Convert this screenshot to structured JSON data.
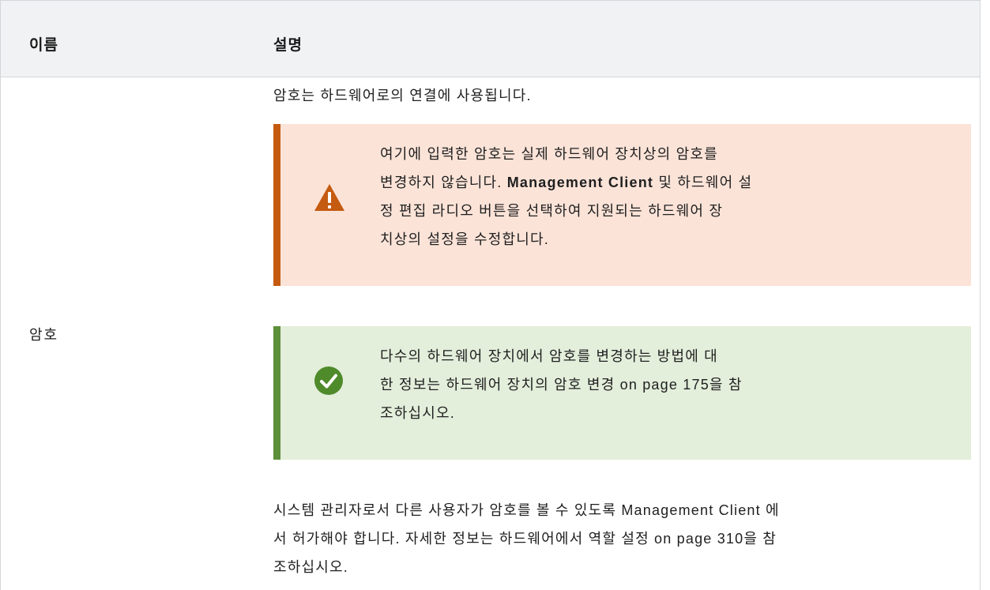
{
  "table": {
    "headers": {
      "name": "이름",
      "description": "설명"
    },
    "row": {
      "name": "암호",
      "intro": "암호는 하드웨어로의 연결에 사용됩니다.",
      "warning": {
        "line1": "여기에 입력한 암호는 실제 하드웨어 장치상의 암호를",
        "line2_prefix": "변경하지 않습니다. ",
        "line2_bold": "Management Client",
        "line2_suffix": " 및 하드웨어 설",
        "line3": "정 편집 라디오 버튼을 선택하여 지원되는 하드웨어 장",
        "line4": "치상의 설정을 수정합니다.",
        "icon": "warning-triangle-icon",
        "accent_color": "#c55a11",
        "background": "#fbe3d8"
      },
      "tip": {
        "line1": "다수의 하드웨어 장치에서 암호를 변경하는 방법에 대",
        "line2": "한 정보는 하드웨어 장치의 암호 변경 on page 175을 참",
        "line3": "조하십시오.",
        "icon": "check-circle-icon",
        "accent_color": "#5b8f3a",
        "background": "#e3eedb"
      },
      "outro": {
        "line1": "시스템 관리자로서 다른 사용자가 암호를 볼 수 있도록 Management Client 에",
        "line2": "서 허가해야 합니다. 자세한 정보는 하드웨어에서 역할 설정 on page 310을 참",
        "line3": "조하십시오."
      }
    }
  }
}
